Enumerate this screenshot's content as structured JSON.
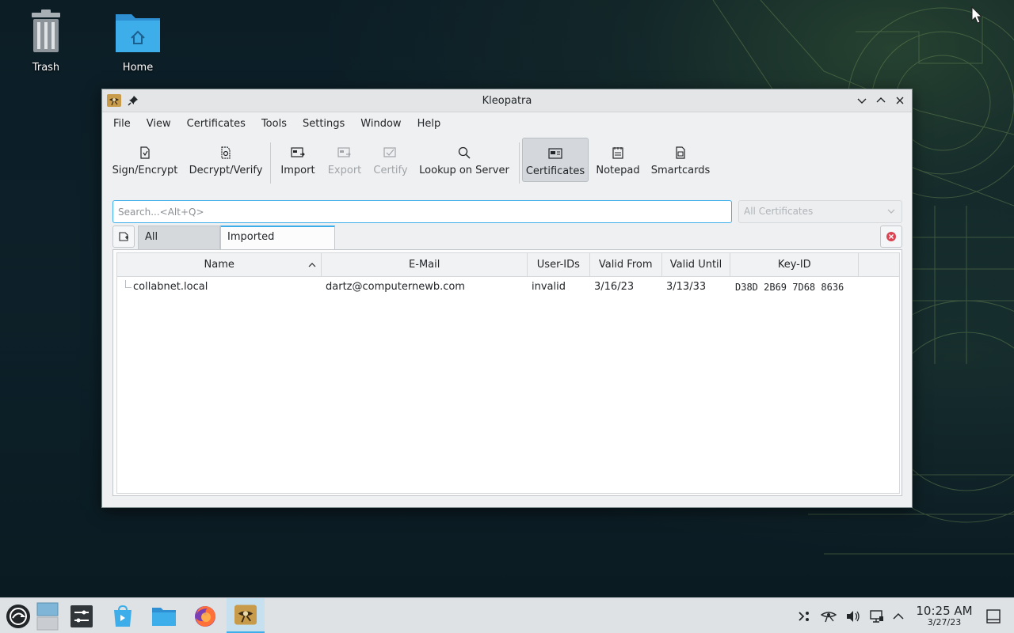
{
  "desktop": {
    "icons": [
      {
        "label": "Trash",
        "icon": "trash-icon"
      },
      {
        "label": "Home",
        "icon": "home-folder-icon"
      }
    ]
  },
  "window": {
    "title": "Kleopatra",
    "menu": [
      "File",
      "View",
      "Certificates",
      "Tools",
      "Settings",
      "Window",
      "Help"
    ],
    "toolbar": {
      "sign_encrypt": "Sign/Encrypt",
      "decrypt_verify": "Decrypt/Verify",
      "import": "Import",
      "export": "Export",
      "certify": "Certify",
      "lookup": "Lookup on Server",
      "certificates": "Certificates",
      "notepad": "Notepad",
      "smartcards": "Smartcards"
    },
    "search": {
      "placeholder": "Search...<Alt+Q>",
      "value": ""
    },
    "filter": {
      "selected": "All Certificates"
    },
    "tabs": [
      {
        "label": "All Certificates",
        "active": false
      },
      {
        "label": "Imported Certificates",
        "active": true
      }
    ],
    "table": {
      "columns": [
        "Name",
        "E-Mail",
        "User-IDs",
        "Valid From",
        "Valid Until",
        "Key-ID"
      ],
      "rows": [
        {
          "name": "collabnet.local",
          "email": "dartz@computernewb.com",
          "user_ids": "invalid",
          "valid_from": "3/16/23",
          "valid_until": "3/13/33",
          "key_id": "D38D 2B69 7D68 8636"
        }
      ]
    }
  },
  "taskbar": {
    "clock_time": "10:25 AM",
    "clock_date": "3/27/23"
  },
  "colors": {
    "accent": "#3daee9",
    "window_bg": "#eff0f1",
    "taskbar_bg": "#dfe2e5"
  }
}
